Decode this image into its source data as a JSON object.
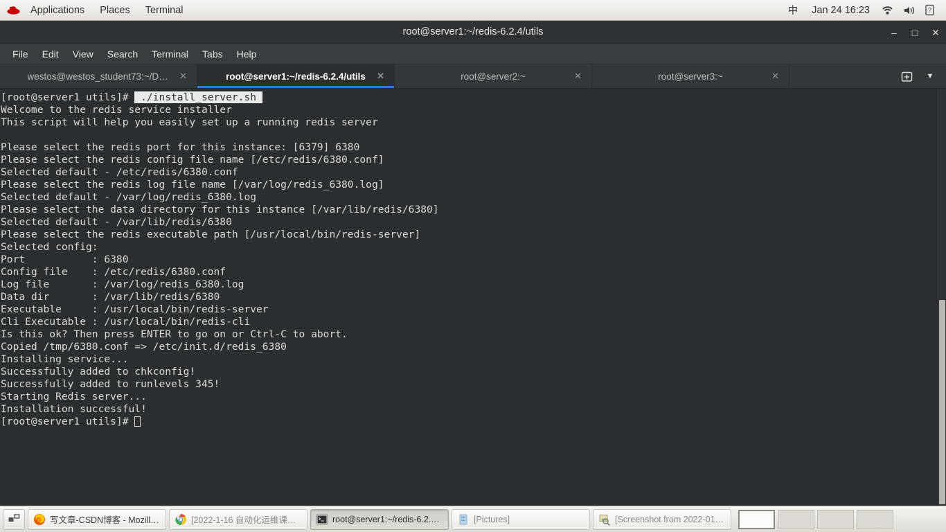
{
  "top_panel": {
    "logo_name": "redhat-logo-icon",
    "menus": [
      "Applications",
      "Places",
      "Terminal"
    ],
    "ime_indicator": "中",
    "clock": "Jan 24  16:23",
    "icons": [
      "wifi-icon",
      "volume-icon",
      "battery-icon"
    ]
  },
  "window": {
    "title": "root@server1:~/redis-6.2.4/utils",
    "buttons": {
      "minimize": "–",
      "maximize": "□",
      "close": "✕"
    }
  },
  "menubar": [
    "File",
    "Edit",
    "View",
    "Search",
    "Terminal",
    "Tabs",
    "Help"
  ],
  "tabs": [
    {
      "label": "westos@westos_student73:~/Deskt…",
      "active": false,
      "close": "✕"
    },
    {
      "label": "root@server1:~/redis-6.2.4/utils",
      "active": true,
      "close": "✕"
    },
    {
      "label": "root@server2:~",
      "active": false,
      "close": "✕"
    },
    {
      "label": "root@server3:~",
      "active": false,
      "close": "✕"
    }
  ],
  "tab_tools": {
    "new_tab": "new-tab-icon",
    "tab_list": "▼"
  },
  "terminal": {
    "prompt": "[root@server1 utils]# ",
    "selected_command": "./install_server.sh",
    "lines": [
      "Welcome to the redis service installer",
      "This script will help you easily set up a running redis server",
      "",
      "Please select the redis port for this instance: [6379] 6380",
      "Please select the redis config file name [/etc/redis/6380.conf]",
      "Selected default - /etc/redis/6380.conf",
      "Please select the redis log file name [/var/log/redis_6380.log]",
      "Selected default - /var/log/redis_6380.log",
      "Please select the data directory for this instance [/var/lib/redis/6380]",
      "Selected default - /var/lib/redis/6380",
      "Please select the redis executable path [/usr/local/bin/redis-server]",
      "Selected config:",
      "Port           : 6380",
      "Config file    : /etc/redis/6380.conf",
      "Log file       : /var/log/redis_6380.log",
      "Data dir       : /var/lib/redis/6380",
      "Executable     : /usr/local/bin/redis-server",
      "Cli Executable : /usr/local/bin/redis-cli",
      "Is this ok? Then press ENTER to go on or Ctrl-C to abort.",
      "Copied /tmp/6380.conf => /etc/init.d/redis_6380",
      "Installing service...",
      "Successfully added to chkconfig!",
      "Successfully added to runlevels 345!",
      "Starting Redis server...",
      "Installation successful!"
    ],
    "final_prompt": "[root@server1 utils]# "
  },
  "taskbar": {
    "show_desktop": "show-desktop-icon",
    "tasks": [
      {
        "label": "写文章-CSDN博客 - Mozilla…",
        "icon": "firefox-icon",
        "active": false,
        "dim": false
      },
      {
        "label": "[2022-1-16 自动化运维课…",
        "icon": "chrome-icon",
        "active": false,
        "dim": true
      },
      {
        "label": "root@server1:~/redis-6.2.…",
        "icon": "terminal-icon",
        "active": true,
        "dim": false
      },
      {
        "label": "[Pictures]",
        "icon": "file-manager-icon",
        "active": false,
        "dim": true
      },
      {
        "label": "[Screenshot from 2022-01…",
        "icon": "image-viewer-icon",
        "active": false,
        "dim": true
      }
    ],
    "workspaces": [
      {
        "active": true
      },
      {
        "active": false
      },
      {
        "active": false
      },
      {
        "active": false
      }
    ]
  },
  "colors": {
    "terminal_bg": "#2b2f31",
    "terminal_fg": "#d9dbdb",
    "tab_accent": "#2b7fd4",
    "selection_bg": "#e9e9e7"
  }
}
